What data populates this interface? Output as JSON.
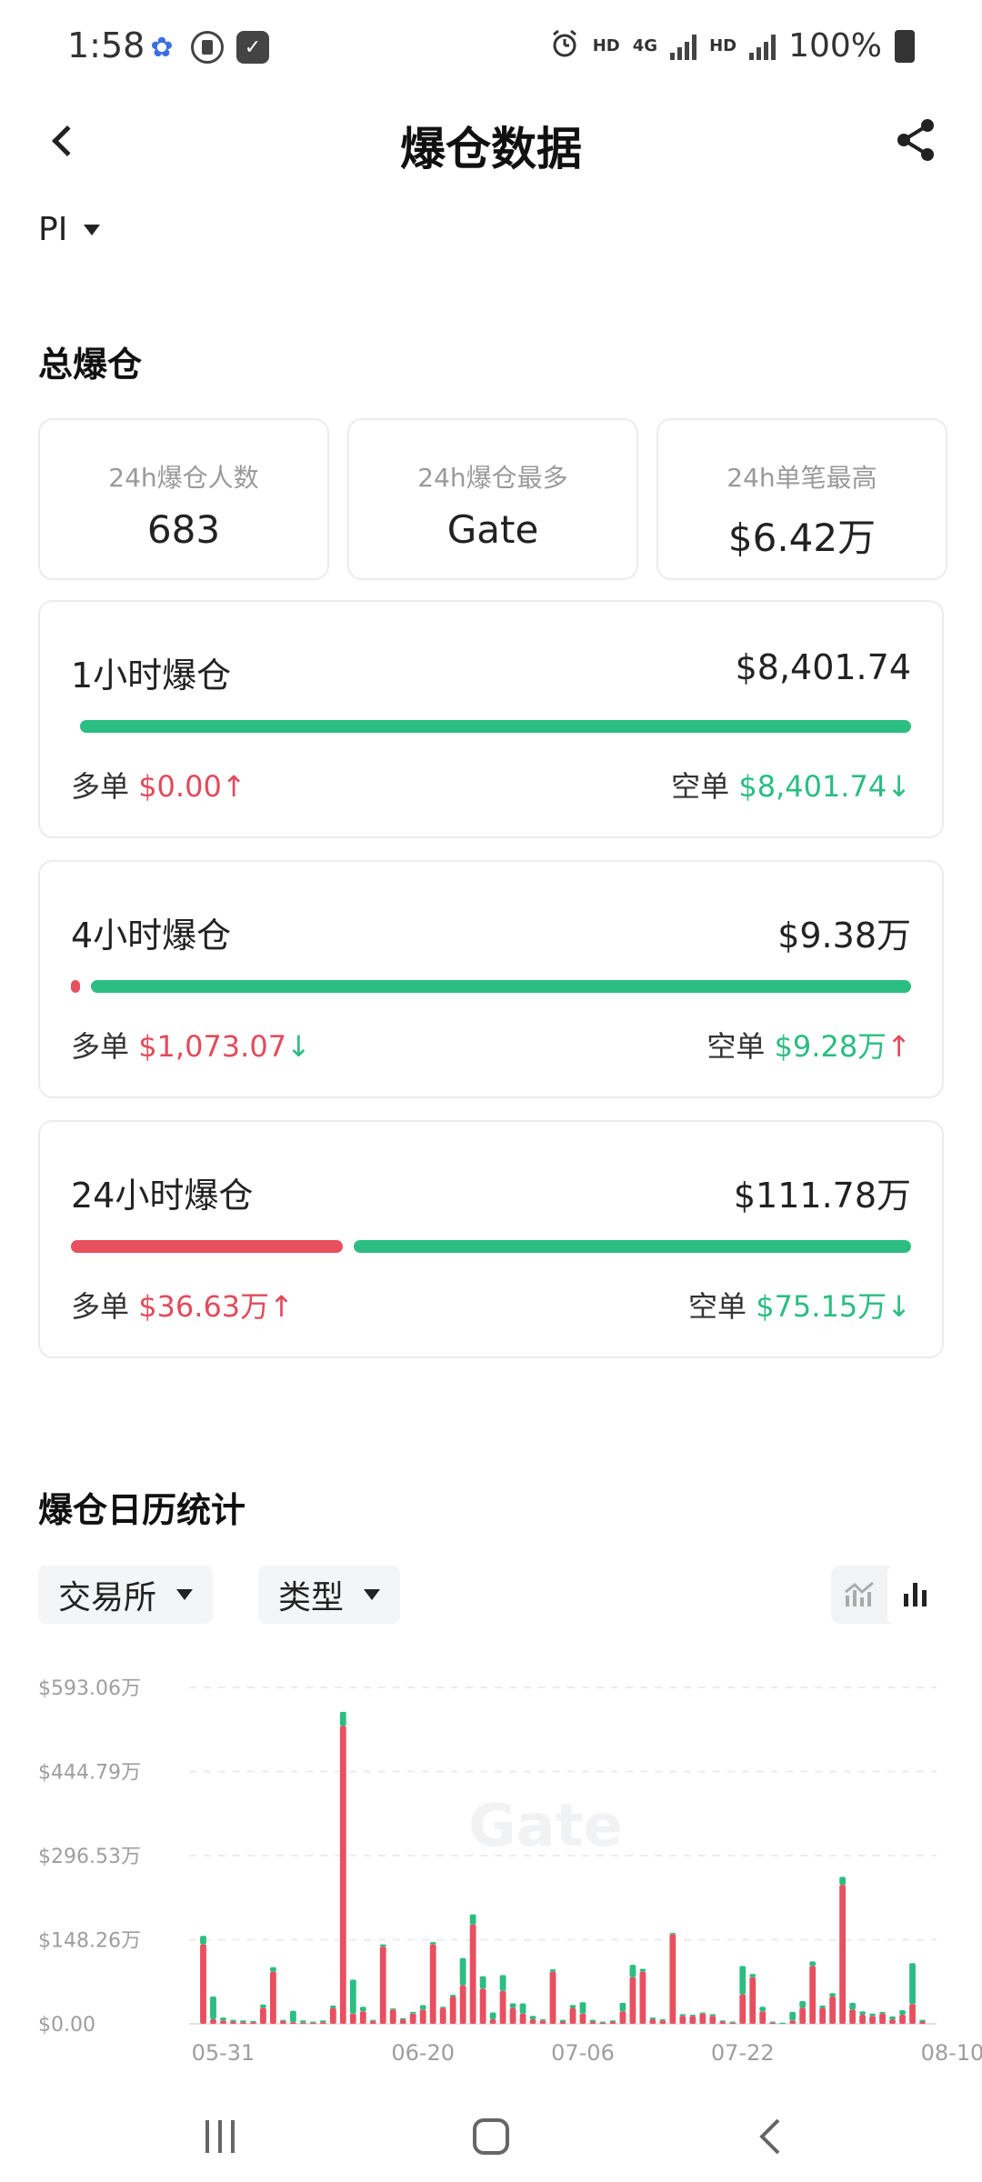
{
  "status_bar": {
    "time": "1:58",
    "network_1": "HD",
    "network_gen": "4G",
    "network_2": "HD",
    "battery": "100%"
  },
  "header": {
    "title": "爆仓数据"
  },
  "coin": {
    "symbol": "PI"
  },
  "total": {
    "section_title": "总爆仓",
    "stats": [
      {
        "label": "24h爆仓人数",
        "value": "683"
      },
      {
        "label": "24h爆仓最多",
        "value": "Gate"
      },
      {
        "label": "24h单笔最高",
        "value": "$6.42万"
      }
    ]
  },
  "liquidations": [
    {
      "title": "1小时爆仓",
      "total": "$8,401.74",
      "long_label": "多单",
      "long_value": "$0.00",
      "long_arrow": "↑",
      "short_label": "空单",
      "short_value": "$8,401.74",
      "short_arrow": "↓",
      "long_fraction": 0.0
    },
    {
      "title": "4小时爆仓",
      "total": "$9.38万",
      "long_label": "多单",
      "long_value": "$1,073.07",
      "long_arrow": "↓",
      "short_label": "空单",
      "short_value": "$9.28万",
      "short_arrow": "↑",
      "long_fraction": 0.011
    },
    {
      "title": "24小时爆仓",
      "total": "$111.78万",
      "long_label": "多单",
      "long_value": "$36.63万",
      "long_arrow": "↑",
      "short_label": "空单",
      "short_value": "$75.15万",
      "short_arrow": "↓",
      "long_fraction": 0.328
    }
  ],
  "calendar": {
    "section_title": "爆仓日历统计",
    "filters": [
      "交易所",
      "类型"
    ],
    "view_modes": [
      "line-chart-icon",
      "bar-chart-icon"
    ],
    "active_view": "bar-chart-icon"
  },
  "chart_data": {
    "type": "bar",
    "stacked": true,
    "watermark": "Gate",
    "y_ticks": [
      "$593.06万",
      "$444.79万",
      "$296.53万",
      "$148.26万",
      "$0.00"
    ],
    "ylim": [
      0,
      593.06
    ],
    "x_tick_labels": [
      "05-31",
      "06-20",
      "07-06",
      "07-22",
      "08-10"
    ],
    "x_tick_indices": [
      2,
      22,
      38,
      54,
      75
    ],
    "grid": true,
    "colors": {
      "long": "#e8505f",
      "short": "#2cbd82"
    },
    "series": [
      {
        "key": "long",
        "values": [
          140,
          8,
          6,
          4,
          3,
          3,
          28,
          92,
          5,
          3,
          2,
          2,
          3,
          28,
          525,
          18,
          22,
          5,
          136,
          25,
          8,
          18,
          25,
          140,
          28,
          48,
          68,
          175,
          62,
          8,
          58,
          28,
          18,
          8,
          6,
          92,
          4,
          28,
          18,
          4,
          2,
          4,
          22,
          82,
          92,
          8,
          6,
          158,
          14,
          14,
          18,
          14,
          4,
          2,
          52,
          82,
          22,
          2,
          0,
          6,
          28,
          102,
          28,
          48,
          245,
          25,
          16,
          14,
          18,
          8,
          16,
          35,
          4
        ]
      },
      {
        "key": "short",
        "values": [
          15,
          40,
          5,
          3,
          3,
          2,
          6,
          8,
          2,
          20,
          4,
          2,
          3,
          4,
          25,
          60,
          8,
          2,
          4,
          2,
          2,
          3,
          8,
          4,
          2,
          3,
          48,
          18,
          22,
          12,
          28,
          8,
          18,
          6,
          2,
          4,
          3,
          5,
          20,
          3,
          2,
          2,
          15,
          22,
          5,
          3,
          2,
          2,
          3,
          2,
          2,
          3,
          2,
          2,
          50,
          6,
          8,
          2,
          2,
          15,
          12,
          8,
          4,
          6,
          14,
          12,
          6,
          4,
          3,
          5,
          8,
          72,
          3
        ]
      }
    ]
  }
}
